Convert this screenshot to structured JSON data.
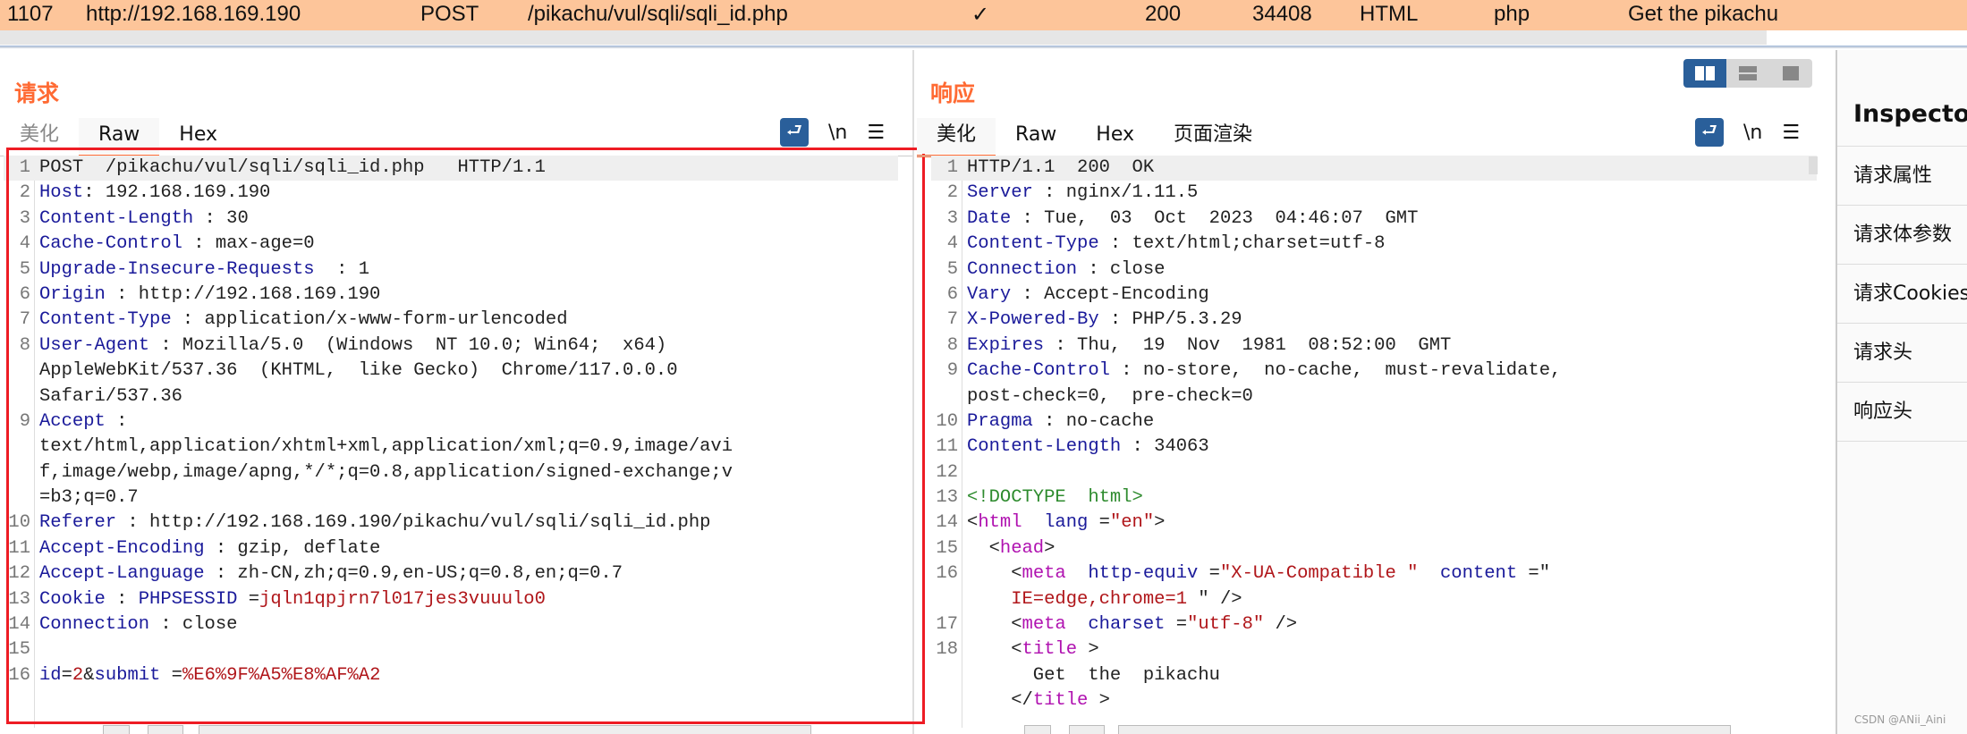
{
  "history_row": {
    "id": "1107",
    "host": "http://192.168.169.190",
    "method": "POST",
    "url": "/pikachu/vul/sqli/sqli_id.php",
    "params": "✓",
    "status": "200",
    "length": "34408",
    "mime": "HTML",
    "ext": "php",
    "title": "Get the pikachu"
  },
  "colors": {
    "accent": "#ff6a33",
    "selected_row": "#fdc59a",
    "key": "#1a1a9a",
    "string": "#b0161a",
    "tag": "#b012b0",
    "highlight_box": "#ee1c24"
  },
  "request": {
    "title": "请求",
    "tabs": [
      {
        "label": "美化"
      },
      {
        "label": "Raw"
      },
      {
        "label": "Hex"
      }
    ],
    "active_tab": "Raw",
    "tools": {
      "wrap_icon": "word-wrap-icon",
      "newline_label": "\\n",
      "menu_icon": "hamburger-icon"
    },
    "lines": [
      {
        "n": "1",
        "rows": [
          [
            {
              "t": "POST  /pikachu/vul/sqli/sqli_id.php   HTTP/1.1",
              "c": "v"
            }
          ]
        ]
      },
      {
        "n": "2",
        "rows": [
          [
            {
              "t": "Host",
              "c": "k"
            },
            {
              "t": ": 192.168.169.190",
              "c": "v"
            }
          ]
        ]
      },
      {
        "n": "3",
        "rows": [
          [
            {
              "t": "Content-Length",
              "c": "k"
            },
            {
              "t": " : 30",
              "c": "v"
            }
          ]
        ]
      },
      {
        "n": "4",
        "rows": [
          [
            {
              "t": "Cache-Control",
              "c": "k"
            },
            {
              "t": " : max-age=0",
              "c": "v"
            }
          ]
        ]
      },
      {
        "n": "5",
        "rows": [
          [
            {
              "t": "Upgrade-Insecure-Requests",
              "c": "k"
            },
            {
              "t": "  : 1",
              "c": "v"
            }
          ]
        ]
      },
      {
        "n": "6",
        "rows": [
          [
            {
              "t": "Origin",
              "c": "k"
            },
            {
              "t": " : http://192.168.169.190",
              "c": "v"
            }
          ]
        ]
      },
      {
        "n": "7",
        "rows": [
          [
            {
              "t": "Content-Type",
              "c": "k"
            },
            {
              "t": " : application/x-www-form-urlencoded",
              "c": "v"
            }
          ]
        ]
      },
      {
        "n": "8",
        "rows": [
          [
            {
              "t": "User-Agent",
              "c": "k"
            },
            {
              "t": " : Mozilla/5.0  (Windows  NT 10.0; Win64;  x64)",
              "c": "v"
            }
          ],
          [
            {
              "t": "AppleWebKit/537.36  (KHTML,  like Gecko)  Chrome/117.0.0.0",
              "c": "v"
            }
          ],
          [
            {
              "t": "Safari/537.36",
              "c": "v"
            }
          ]
        ]
      },
      {
        "n": "9",
        "rows": [
          [
            {
              "t": "Accept",
              "c": "k"
            },
            {
              "t": " :",
              "c": "v"
            }
          ],
          [
            {
              "t": "text/html,application/xhtml+xml,application/xml;q=0.9,image/avi",
              "c": "v"
            }
          ],
          [
            {
              "t": "f,image/webp,image/apng,*/*;q=0.8,application/signed-exchange;v",
              "c": "v"
            }
          ],
          [
            {
              "t": "=b3;q=0.7",
              "c": "v"
            }
          ]
        ]
      },
      {
        "n": "10",
        "rows": [
          [
            {
              "t": "Referer",
              "c": "k"
            },
            {
              "t": " : http://192.168.169.190/pikachu/vul/sqli/sqli_id.php",
              "c": "v"
            }
          ]
        ]
      },
      {
        "n": "11",
        "rows": [
          [
            {
              "t": "Accept-Encoding",
              "c": "k"
            },
            {
              "t": " : gzip, deflate",
              "c": "v"
            }
          ]
        ]
      },
      {
        "n": "12",
        "rows": [
          [
            {
              "t": "Accept-Language",
              "c": "k"
            },
            {
              "t": " : zh-CN,zh;q=0.9,en-US;q=0.8,en;q=0.7",
              "c": "v"
            }
          ]
        ]
      },
      {
        "n": "13",
        "rows": [
          [
            {
              "t": "Cookie",
              "c": "k"
            },
            {
              "t": " : ",
              "c": "v"
            },
            {
              "t": "PHPSESSID",
              "c": "k"
            },
            {
              "t": " =",
              "c": "v"
            },
            {
              "t": "jqln1qpjrn7l017jes3vuuulo0",
              "c": "s"
            }
          ]
        ]
      },
      {
        "n": "14",
        "rows": [
          [
            {
              "t": "Connection",
              "c": "k"
            },
            {
              "t": " : close",
              "c": "v"
            }
          ]
        ]
      },
      {
        "n": "15",
        "rows": [
          [
            {
              "t": "",
              "c": "v"
            }
          ]
        ]
      },
      {
        "n": "16",
        "rows": [
          [
            {
              "t": "id",
              "c": "k"
            },
            {
              "t": "=",
              "c": "v"
            },
            {
              "t": "2",
              "c": "s"
            },
            {
              "t": "&",
              "c": "v"
            },
            {
              "t": "submit",
              "c": "k"
            },
            {
              "t": " =",
              "c": "v"
            },
            {
              "t": "%E6%9F%A5%E8%AF%A2",
              "c": "s"
            }
          ]
        ]
      }
    ]
  },
  "response": {
    "title": "响应",
    "tabs": [
      {
        "label": "美化"
      },
      {
        "label": "Raw"
      },
      {
        "label": "Hex"
      },
      {
        "label": "页面渲染"
      }
    ],
    "active_tab": "美化",
    "tools": {
      "wrap_icon": "word-wrap-icon",
      "newline_label": "\\n",
      "menu_icon": "hamburger-icon"
    },
    "lines": [
      {
        "n": "1",
        "rows": [
          [
            {
              "t": "HTTP/1.1  200  OK",
              "c": "v"
            }
          ]
        ]
      },
      {
        "n": "2",
        "rows": [
          [
            {
              "t": "Server",
              "c": "k"
            },
            {
              "t": " : nginx/1.11.5",
              "c": "v"
            }
          ]
        ]
      },
      {
        "n": "3",
        "rows": [
          [
            {
              "t": "Date",
              "c": "k"
            },
            {
              "t": " : Tue,  03  Oct  2023  04:46:07  GMT",
              "c": "v"
            }
          ]
        ]
      },
      {
        "n": "4",
        "rows": [
          [
            {
              "t": "Content-Type",
              "c": "k"
            },
            {
              "t": " : text/html;charset=utf-8",
              "c": "v"
            }
          ]
        ]
      },
      {
        "n": "5",
        "rows": [
          [
            {
              "t": "Connection",
              "c": "k"
            },
            {
              "t": " : close",
              "c": "v"
            }
          ]
        ]
      },
      {
        "n": "6",
        "rows": [
          [
            {
              "t": "Vary",
              "c": "k"
            },
            {
              "t": " : Accept-Encoding",
              "c": "v"
            }
          ]
        ]
      },
      {
        "n": "7",
        "rows": [
          [
            {
              "t": "X-Powered-By",
              "c": "k"
            },
            {
              "t": " : PHP/5.3.29",
              "c": "v"
            }
          ]
        ]
      },
      {
        "n": "8",
        "rows": [
          [
            {
              "t": "Expires",
              "c": "k"
            },
            {
              "t": " : Thu,  19  Nov  1981  08:52:00  GMT",
              "c": "v"
            }
          ]
        ]
      },
      {
        "n": "9",
        "rows": [
          [
            {
              "t": "Cache-Control",
              "c": "k"
            },
            {
              "t": " : no-store,  no-cache,  must-revalidate,",
              "c": "v"
            }
          ],
          [
            {
              "t": "post-check=0,  pre-check=0",
              "c": "v"
            }
          ]
        ]
      },
      {
        "n": "10",
        "rows": [
          [
            {
              "t": "Pragma",
              "c": "k"
            },
            {
              "t": " : no-cache",
              "c": "v"
            }
          ]
        ]
      },
      {
        "n": "11",
        "rows": [
          [
            {
              "t": "Content-Length",
              "c": "k"
            },
            {
              "t": " : 34063",
              "c": "v"
            }
          ]
        ]
      },
      {
        "n": "12",
        "rows": [
          [
            {
              "t": "",
              "c": "v"
            }
          ]
        ]
      },
      {
        "n": "13",
        "rows": [
          [
            {
              "t": "<!DOCTYPE  html>",
              "c": "d"
            }
          ]
        ]
      },
      {
        "n": "14",
        "rows": [
          [
            {
              "t": "<",
              "c": "v"
            },
            {
              "t": "html",
              "c": "tag"
            },
            {
              "t": "  lang",
              "c": "k"
            },
            {
              "t": " =",
              "c": "v"
            },
            {
              "t": "\"en\"",
              "c": "s"
            },
            {
              "t": ">",
              "c": "v"
            }
          ]
        ]
      },
      {
        "n": "15",
        "rows": [
          [
            {
              "t": "  <",
              "c": "v"
            },
            {
              "t": "head",
              "c": "tag"
            },
            {
              "t": ">",
              "c": "v"
            }
          ]
        ]
      },
      {
        "n": "16",
        "rows": [
          [
            {
              "t": "    <",
              "c": "v"
            },
            {
              "t": "meta",
              "c": "tag"
            },
            {
              "t": "  http-equiv",
              "c": "k"
            },
            {
              "t": " =",
              "c": "v"
            },
            {
              "t": "\"X-UA-Compatible \"",
              "c": "s"
            },
            {
              "t": "  content",
              "c": "k"
            },
            {
              "t": " =\"",
              "c": "v"
            }
          ],
          [
            {
              "t": "    IE=edge,chrome=1 ",
              "c": "s"
            },
            {
              "t": "\" />",
              "c": "v"
            }
          ]
        ]
      },
      {
        "n": "17",
        "rows": [
          [
            {
              "t": "    <",
              "c": "v"
            },
            {
              "t": "meta",
              "c": "tag"
            },
            {
              "t": "  charset",
              "c": "k"
            },
            {
              "t": " =",
              "c": "v"
            },
            {
              "t": "\"utf-8\"",
              "c": "s"
            },
            {
              "t": " />",
              "c": "v"
            }
          ]
        ]
      },
      {
        "n": "18",
        "rows": [
          [
            {
              "t": "    <",
              "c": "v"
            },
            {
              "t": "title",
              "c": "tag"
            },
            {
              "t": " >",
              "c": "v"
            }
          ],
          [
            {
              "t": "      Get  the  pikachu",
              "c": "v"
            }
          ],
          [
            {
              "t": "    </",
              "c": "v"
            },
            {
              "t": "title",
              "c": "tag"
            },
            {
              "t": " >",
              "c": "v"
            }
          ]
        ]
      }
    ]
  },
  "view_toggle": {
    "options": [
      "side-by-side",
      "stacked",
      "single"
    ],
    "selected": "side-by-side"
  },
  "inspector": {
    "title": "Inspector",
    "items": [
      {
        "label": "请求属性"
      },
      {
        "label": "请求体参数"
      },
      {
        "label": "请求Cookies"
      },
      {
        "label": "请求头"
      },
      {
        "label": "响应头"
      }
    ]
  },
  "watermark": "CSDN @ANii_Aini"
}
